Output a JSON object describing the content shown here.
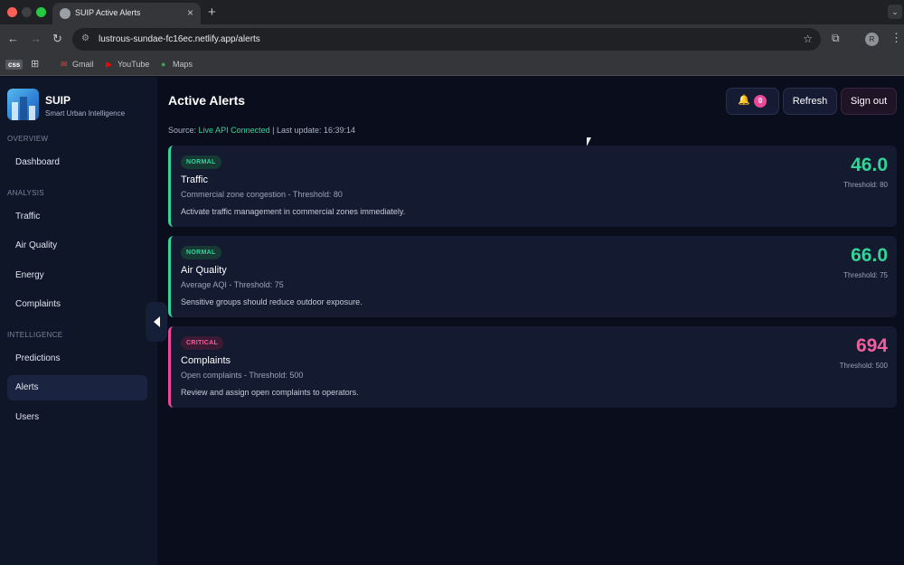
{
  "browser": {
    "tab_title": "SUIP Active Alerts",
    "url": "lustrous-sundae-fc16ec.netlify.app/alerts",
    "profile_initial": "R",
    "bookmarks": [
      "css",
      "Gmail",
      "YouTube",
      "Maps"
    ]
  },
  "sidebar": {
    "brand_name": "SUIP",
    "brand_sub": "Smart Urban Intelligence",
    "sections": {
      "overview": "OVERVIEW",
      "analysis": "ANALYSIS",
      "intelligence": "INTELLIGENCE"
    },
    "items": {
      "dashboard": "Dashboard",
      "traffic": "Traffic",
      "air_quality": "Air Quality",
      "energy": "Energy",
      "complaints": "Complaints",
      "predictions": "Predictions",
      "alerts": "Alerts",
      "users": "Users"
    },
    "active_item": "Alerts"
  },
  "header": {
    "title": "Active Alerts",
    "notification_count": "0",
    "refresh_label": "Refresh",
    "signout_label": "Sign out"
  },
  "status": {
    "source_label": "Source:",
    "source_value": "Live API Connected",
    "last_update": "| Last update: 16:39:14"
  },
  "alerts": [
    {
      "status": "NORMAL",
      "title": "Traffic",
      "meta": "Commercial zone congestion - Threshold: 80",
      "description": "Activate traffic management in commercial zones immediately.",
      "value": "46.0",
      "threshold": "Threshold: 80"
    },
    {
      "status": "NORMAL",
      "title": "Air Quality",
      "meta": "Average AQI - Threshold: 75",
      "description": "Sensitive groups should reduce outdoor exposure.",
      "value": "66.0",
      "threshold": "Threshold: 75"
    },
    {
      "status": "CRITICAL",
      "title": "Complaints",
      "meta": "Open complaints - Threshold: 500",
      "description": "Review and assign open complaints to operators.",
      "value": "694",
      "threshold": "Threshold: 500"
    }
  ],
  "colors": {
    "normal": "#34d399",
    "critical": "#ec4899",
    "background": "#0a0e1c",
    "sidebar": "#0f1628",
    "card": "#141a30"
  }
}
